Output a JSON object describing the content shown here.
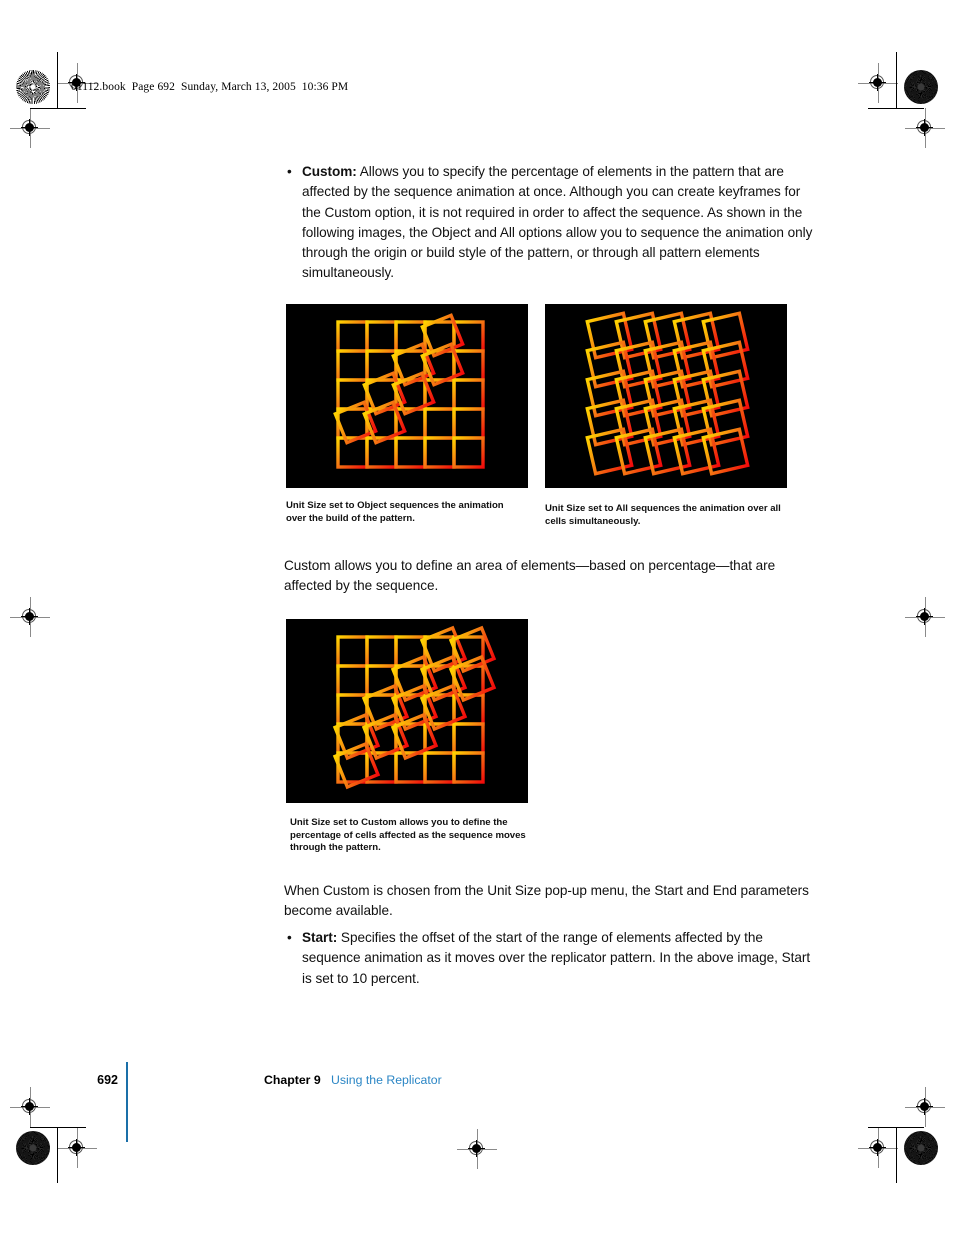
{
  "document": {
    "file_header": "01112.book  Page 692  Sunday, March 13, 2005  10:36 PM",
    "page_number": "692",
    "chapter_label": "Chapter 9",
    "chapter_title": "Using the Replicator",
    "accent_color": "#2b86c5",
    "rule_color": "#1a6fa8"
  },
  "body": {
    "bullet_glyph": "•",
    "bullet_custom": {
      "lead": "Custom:",
      "text": "  Allows you to specify the percentage of elements in the pattern that are affected by the sequence animation at once. Although you can create keyframes for the Custom option, it is not required in order to affect the sequence. As shown in the following images, the Object and All options allow you to sequence the animation only through the origin or build style of the pattern, or through all pattern elements simultaneously."
    },
    "paragraph_custom_area": "Custom allows you to define an area of elements—based on percentage—that are affected by the sequence.",
    "paragraph_when_custom": "When Custom is chosen from the Unit Size pop-up menu, the Start and End parameters become available.",
    "bullet_start": {
      "lead": "Start:",
      "text": "  Specifies the offset of the start of the range of elements affected by the sequence animation as it moves over the replicator pattern. In the above image, Start is set to 10 percent."
    }
  },
  "figures": [
    {
      "id": "figure-object",
      "caption": "Unit Size set to Object sequences the animation over the build of the pattern.",
      "unit_size": "Object",
      "grid": 5,
      "rotated_cells": [
        [
          0,
          3
        ],
        [
          1,
          2
        ],
        [
          1,
          3
        ],
        [
          2,
          1
        ],
        [
          2,
          2
        ],
        [
          3,
          0
        ],
        [
          3,
          1
        ]
      ],
      "rotation_deg": 20,
      "bg_color": "#000000",
      "color_top_left": "#ffd400",
      "color_bottom_right": "#f20b0b"
    },
    {
      "id": "figure-all",
      "caption": "Unit Size set to All sequences the animation over all cells simultaneously.",
      "unit_size": "All",
      "grid": 5,
      "rotated_cells": "all",
      "rotation_deg": 12,
      "bg_color": "#000000",
      "color_top_left": "#ffd400",
      "color_bottom_right": "#f20b0b"
    },
    {
      "id": "figure-custom",
      "caption": "Unit Size set to Custom allows you to define the percentage of cells affected as the sequence moves through the pattern.",
      "unit_size": "Custom",
      "grid": 5,
      "rotated_cells": [
        [
          0,
          3
        ],
        [
          0,
          4
        ],
        [
          1,
          2
        ],
        [
          1,
          3
        ],
        [
          1,
          4
        ],
        [
          2,
          1
        ],
        [
          2,
          2
        ],
        [
          2,
          3
        ],
        [
          3,
          0
        ],
        [
          3,
          1
        ],
        [
          3,
          2
        ],
        [
          4,
          0
        ]
      ],
      "rotation_deg": 20,
      "bg_color": "#000000",
      "color_top_left": "#ffd400",
      "color_bottom_right": "#f20b0b"
    }
  ],
  "marks": {
    "registration": "registration-crosshair",
    "rosette": "halftone-rosette"
  }
}
